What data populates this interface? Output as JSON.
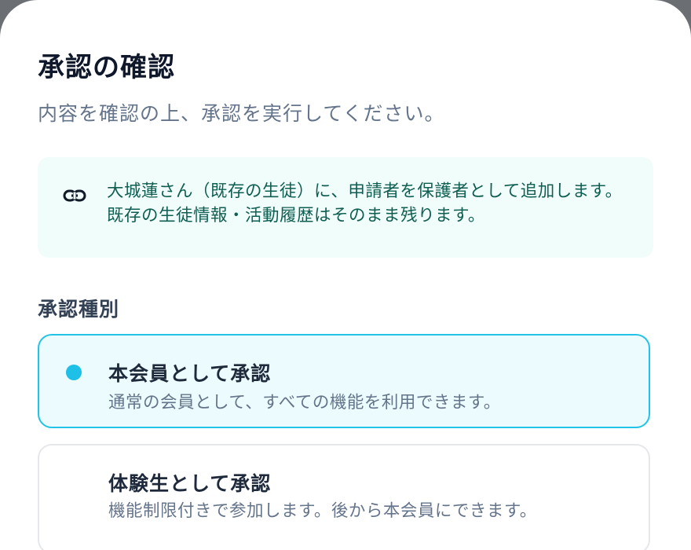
{
  "dialog": {
    "title": "承認の確認",
    "subtitle": "内容を確認の上、承認を実行してください。"
  },
  "info": {
    "icon": "link-icon",
    "text": "大城蓮さん（既存の生徒）に、申請者を保護者として追加します。既存の生徒情報・活動履歴はそのまま残ります。",
    "background_color": "#f0fdfa",
    "text_color": "#0f5e52"
  },
  "approval_type": {
    "label": "承認種別",
    "options": [
      {
        "title": "本会員として承認",
        "description": "通常の会員として、すべての機能を利用できます。",
        "selected": true
      },
      {
        "title": "体験生として承認",
        "description": "機能制限付きで参加します。後から本会員にできます。",
        "selected": false
      }
    ],
    "accent_color": "#22c3e6"
  }
}
